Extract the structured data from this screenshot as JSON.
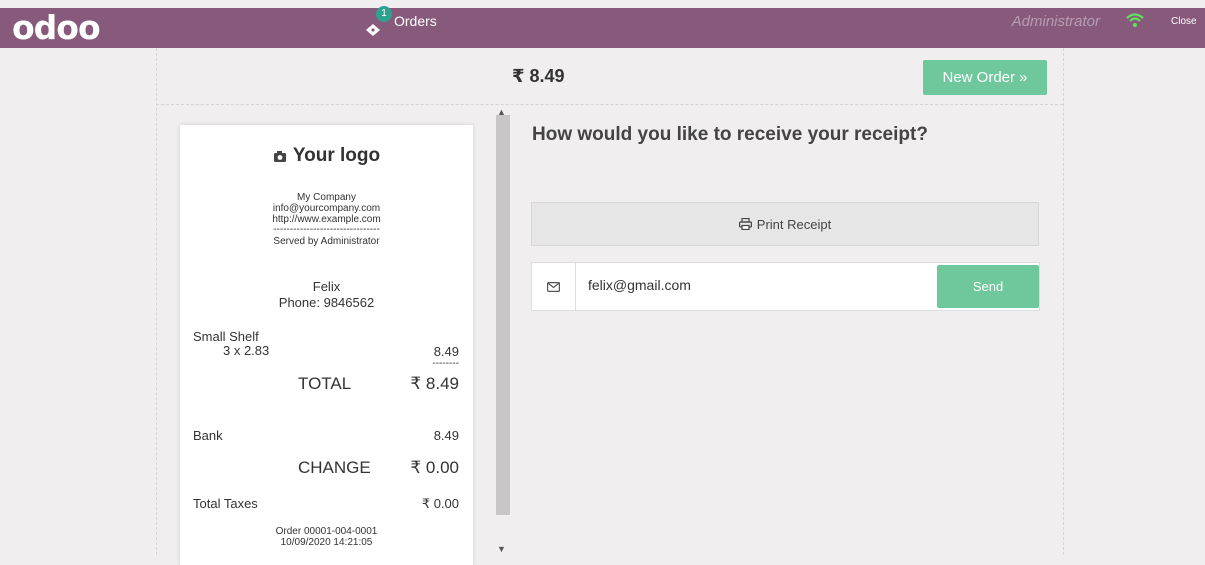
{
  "header": {
    "logo": "odoo",
    "orders_badge": "1",
    "orders_label": "Orders",
    "user": "Administrator",
    "close_label": "Close",
    "icons": [
      "ticket-icon",
      "wifi-icon"
    ],
    "colors": {
      "bar": "#875a7b",
      "badge": "#2fa28f",
      "wifi": "#5fe35a"
    }
  },
  "order_total": "₹ 8.49",
  "new_order_label": "New Order »",
  "receipt": {
    "logo_text": "Your logo",
    "company": "My Company",
    "email": "info@yourcompany.com",
    "website": "http://www.example.com",
    "separator": "--------------------------------",
    "served_by": "Served by Administrator",
    "customer": "Felix",
    "phone": "Phone: 9846562",
    "lines": [
      {
        "product": "Small Shelf",
        "qty_price": "3 x 2.83",
        "amount": "8.49"
      }
    ],
    "amount_separator": "--------",
    "total_label": "TOTAL",
    "total_value": "₹ 8.49",
    "payment_label": "Bank",
    "payment_value": "8.49",
    "change_label": "CHANGE",
    "change_value": "₹ 0.00",
    "taxes_label": "Total Taxes",
    "taxes_value": "₹ 0.00",
    "order_ref": "Order 00001-004-0001",
    "date": "10/09/2020 14:21:05"
  },
  "panel": {
    "question": "How would you like to receive your receipt?",
    "print_label": "Print Receipt",
    "email_value": "felix@gmail.com",
    "send_label": "Send",
    "accent": "#6ec89b"
  }
}
